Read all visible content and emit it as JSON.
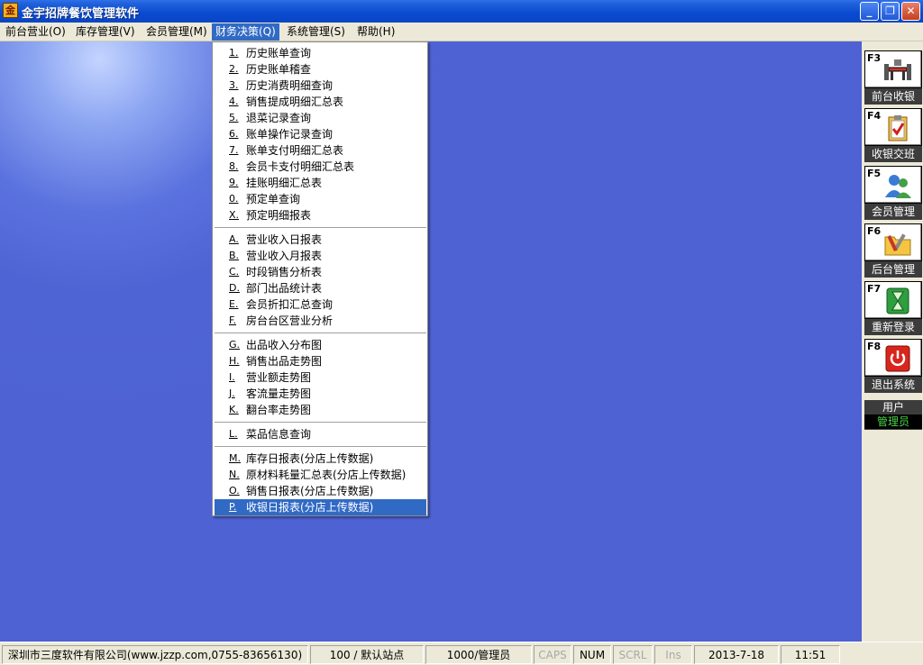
{
  "window": {
    "title": "金宇招牌餐饮管理软件",
    "icon_text": "金",
    "min_glyph": "_",
    "restore_glyph": "❐",
    "close_glyph": "✕"
  },
  "menubar": [
    {
      "label": "前台营业(O)",
      "active": false
    },
    {
      "label": "库存管理(V)",
      "active": false
    },
    {
      "label": "会员管理(M)",
      "active": false
    },
    {
      "label": "财务决策(Q)",
      "active": true
    },
    {
      "label": "系统管理(S)",
      "active": false
    },
    {
      "label": "帮助(H)",
      "active": false
    }
  ],
  "finance_menu": {
    "groups": [
      [
        {
          "key": "1.",
          "label": "历史账单查询"
        },
        {
          "key": "2.",
          "label": "历史账单稽查"
        },
        {
          "key": "3.",
          "label": "历史消费明细查询"
        },
        {
          "key": "4.",
          "label": "销售提成明细汇总表"
        },
        {
          "key": "5.",
          "label": "退菜记录查询"
        },
        {
          "key": "6.",
          "label": "账单操作记录查询"
        },
        {
          "key": "7.",
          "label": "账单支付明细汇总表"
        },
        {
          "key": "8.",
          "label": "会员卡支付明细汇总表"
        },
        {
          "key": "9.",
          "label": "挂账明细汇总表"
        },
        {
          "key": "0.",
          "label": "预定单查询"
        },
        {
          "key": "X.",
          "label": "预定明细报表"
        }
      ],
      [
        {
          "key": "A.",
          "label": "营业收入日报表"
        },
        {
          "key": "B.",
          "label": "营业收入月报表"
        },
        {
          "key": "C.",
          "label": "时段销售分析表"
        },
        {
          "key": "D.",
          "label": "部门出品统计表"
        },
        {
          "key": "E.",
          "label": "会员折扣汇总查询"
        },
        {
          "key": "F.",
          "label": "房台台区营业分析"
        }
      ],
      [
        {
          "key": "G.",
          "label": "出品收入分布图"
        },
        {
          "key": "H.",
          "label": "销售出品走势图"
        },
        {
          "key": "I.",
          "label": "营业额走势图"
        },
        {
          "key": "J.",
          "label": "客流量走势图"
        },
        {
          "key": "K.",
          "label": "翻台率走势图"
        }
      ],
      [
        {
          "key": "L.",
          "label": "菜品信息查询"
        }
      ],
      [
        {
          "key": "M.",
          "label": "库存日报表(分店上传数据)"
        },
        {
          "key": "N.",
          "label": "原材料耗量汇总表(分店上传数据)"
        },
        {
          "key": "O.",
          "label": "销售日报表(分店上传数据)"
        },
        {
          "key": "P.",
          "label": "收银日报表(分店上传数据)",
          "selected": true
        }
      ]
    ]
  },
  "function_buttons": [
    {
      "key": "F3",
      "label": "前台收银",
      "icon": "cashier-table-icon"
    },
    {
      "key": "F4",
      "label": "收银交班",
      "icon": "clipboard-check-icon"
    },
    {
      "key": "F5",
      "label": "会员管理",
      "icon": "members-icon"
    },
    {
      "key": "F6",
      "label": "后台管理",
      "icon": "tools-folder-icon"
    },
    {
      "key": "F7",
      "label": "重新登录",
      "icon": "hourglass-icon"
    },
    {
      "key": "F8",
      "label": "退出系统",
      "icon": "power-icon"
    }
  ],
  "user": {
    "label": "用户",
    "name": "管理员"
  },
  "statusbar": {
    "company": "深圳市三度软件有限公司(www.jzzp.com,0755-83656130)",
    "station": "100 / 默认站点",
    "operator": "1000/管理员",
    "caps": "CAPS",
    "num": "NUM",
    "scrl": "SCRL",
    "ins": "Ins",
    "date": "2013-7-18",
    "time": "11:51"
  },
  "colors": {
    "workspace": "#4e62d3",
    "menu_highlight": "#316ac5",
    "titlebar": "#0a4ad0"
  }
}
